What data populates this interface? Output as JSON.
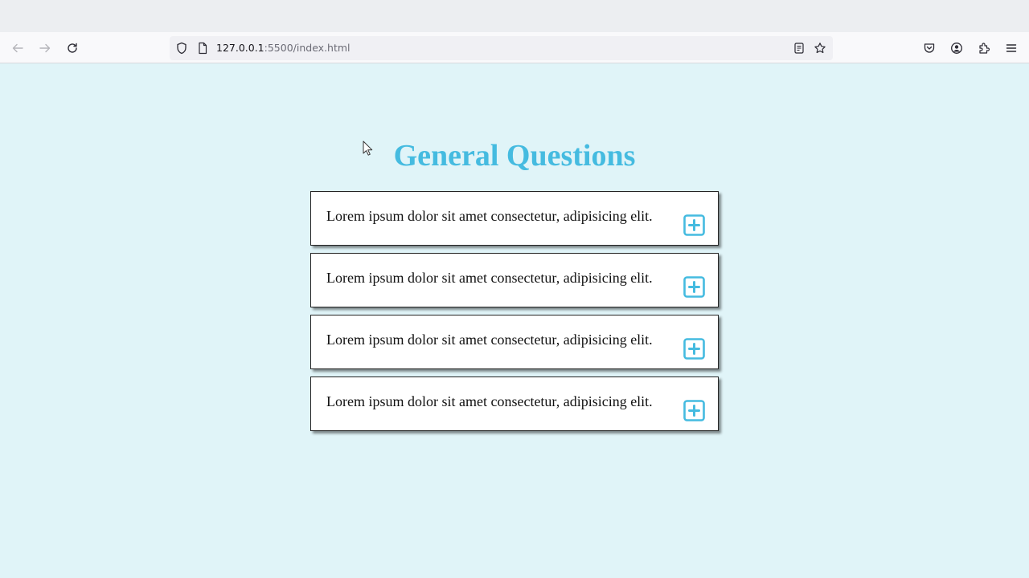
{
  "browser": {
    "url_host": "127.0.0.1",
    "url_rest": ":5500/index.html",
    "icons": {
      "back": "arrow-left-icon",
      "forward": "arrow-right-icon",
      "reload": "reload-icon",
      "shield": "shield-icon",
      "page": "page-icon",
      "reader": "reader-view-icon",
      "bookmark": "star-icon",
      "pocket": "pocket-icon",
      "account": "account-icon",
      "extensions": "extensions-icon",
      "menu": "hamburger-menu-icon"
    }
  },
  "page": {
    "heading": "General Questions",
    "accent_color": "#45bbe0",
    "background_color": "#e0f4f8",
    "faqs": [
      {
        "question": "Lorem ipsum dolor sit amet consectetur, adipisicing elit.",
        "icon": "plus-square-icon"
      },
      {
        "question": "Lorem ipsum dolor sit amet consectetur, adipisicing elit.",
        "icon": "plus-square-icon"
      },
      {
        "question": "Lorem ipsum dolor sit amet consectetur, adipisicing elit.",
        "icon": "plus-square-icon"
      },
      {
        "question": "Lorem ipsum dolor sit amet consectetur, adipisicing elit.",
        "icon": "plus-square-icon"
      }
    ]
  }
}
